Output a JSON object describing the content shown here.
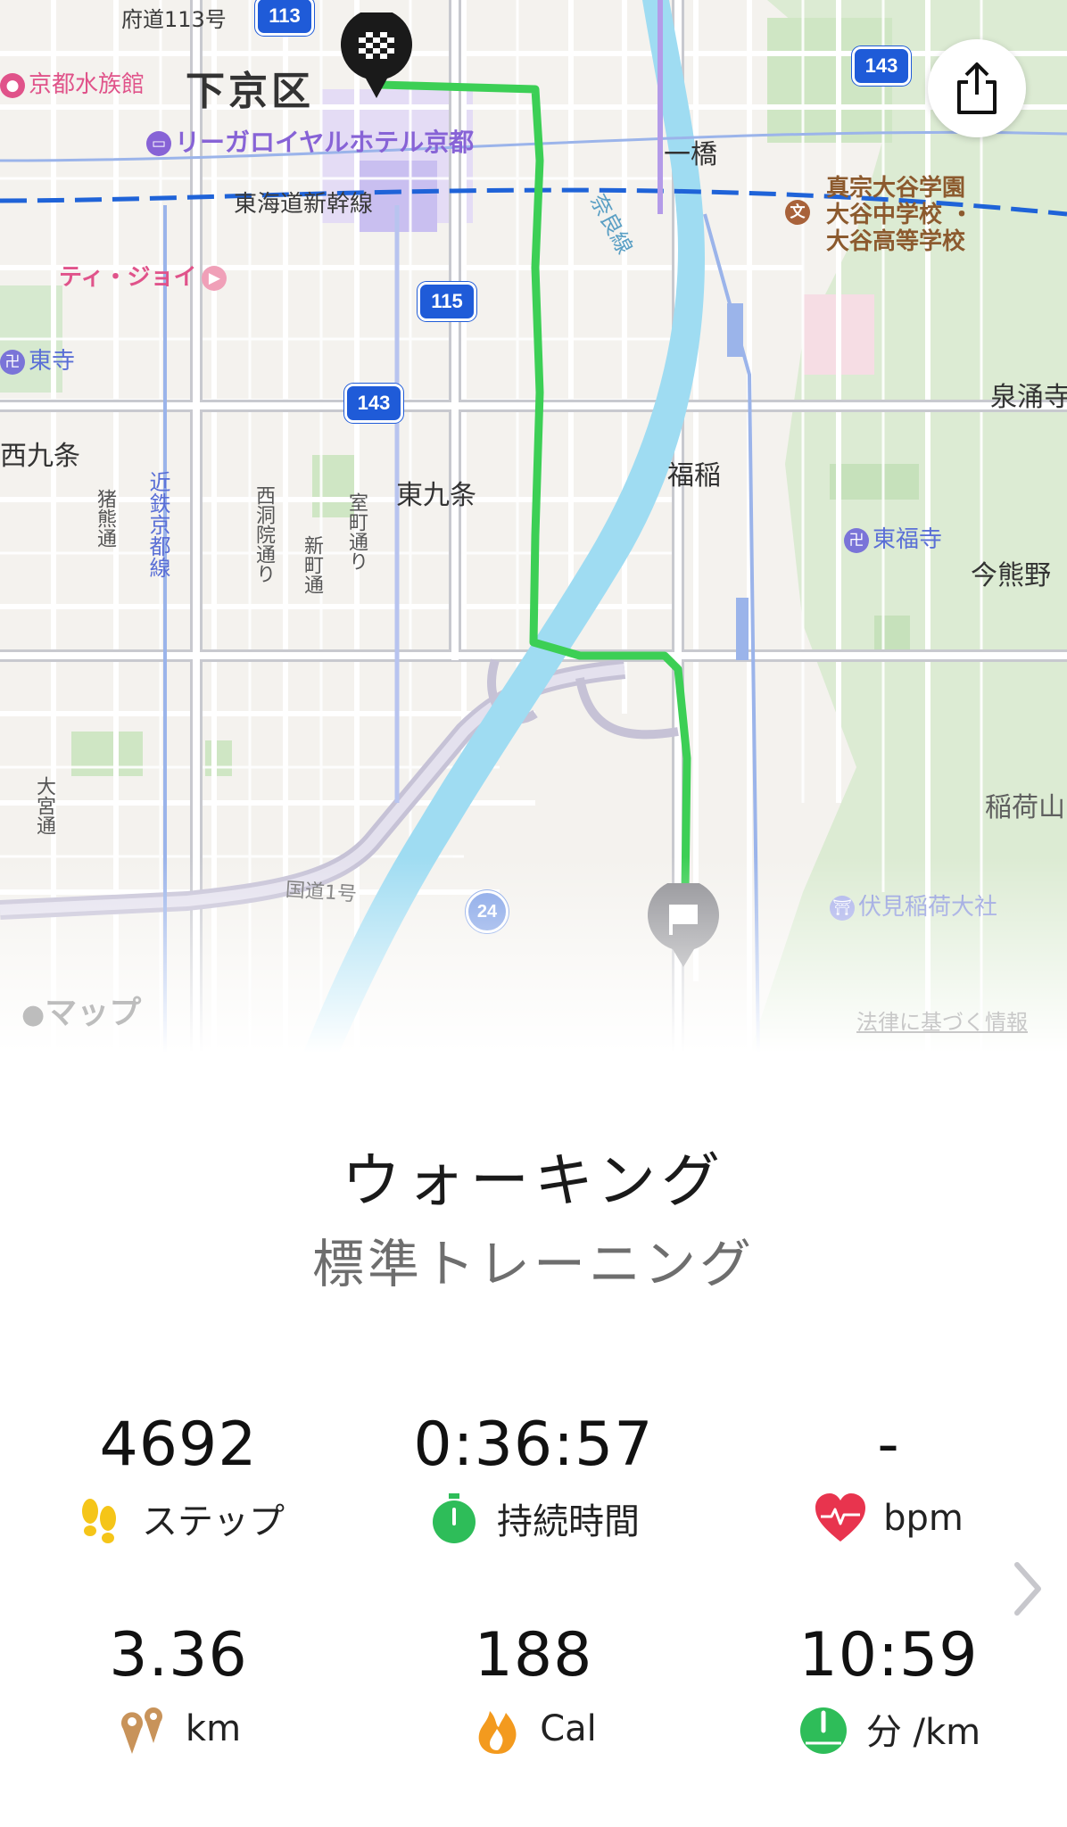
{
  "map": {
    "labels": {
      "fudou113": "府道113号",
      "aquarium": "京都水族館",
      "shimogyo": "下京区",
      "hotel": "リーガロイヤルホテル京都",
      "shinkansen": "東海道新幹線",
      "tjoy": "ティ・ジョイ",
      "toji": "東寺",
      "nishikujo": "西九条",
      "higashikujo": "東九条",
      "ichihashi": "一橋",
      "nara_line": "奈良線",
      "school1": "真宗大谷学園",
      "school2": "大谷中学校 ・",
      "school3": "大谷高等学校",
      "sennyuji": "泉涌寺",
      "fukuine": "福稲",
      "tofukuji": "東福寺",
      "imakumano": "今熊野",
      "inariyama": "稲荷山",
      "fushimi_inari": "伏見稲荷大社",
      "kokudo1": "国道1号",
      "kintetsu": "近鉄京都線",
      "inokuma": "猪熊通",
      "nishinotoin": "西洞院通り",
      "shinmachi": "新町通",
      "muromachi": "室町通り",
      "omiya": "大宮通"
    },
    "shields": {
      "r113": "113",
      "r143a": "143",
      "r143b": "143",
      "r115": "115",
      "r24": "24"
    },
    "attribution": "マップ",
    "legal": "法律に基づく情報",
    "route_color": "#3ccf55",
    "start_icon": "flag-icon",
    "finish_icon": "checkered-flag-icon"
  },
  "workout": {
    "title": "ウォーキング",
    "subtitle": "標準トレーニング"
  },
  "stats": {
    "steps": {
      "value": "4692",
      "label": "ステップ",
      "icon": "footprints-icon"
    },
    "duration": {
      "value": "0:36:57",
      "label": "持続時間",
      "icon": "stopwatch-icon"
    },
    "heart": {
      "value": "-",
      "label": "bpm",
      "icon": "heart-rate-icon"
    },
    "distance": {
      "value": "3.36",
      "label": "km",
      "icon": "location-pins-icon"
    },
    "calories": {
      "value": "188",
      "label": "Cal",
      "icon": "flame-icon"
    },
    "pace": {
      "value": "10:59",
      "label": "分 /km",
      "icon": "speedometer-icon"
    }
  },
  "colors": {
    "route": "#3ccf55",
    "steps_icon": "#f5c518",
    "duration_icon": "#2ebd59",
    "heart_icon": "#e8344e",
    "distance_icon": "#c8935a",
    "calories_icon": "#f39a1e",
    "pace_icon": "#2ebd59"
  }
}
